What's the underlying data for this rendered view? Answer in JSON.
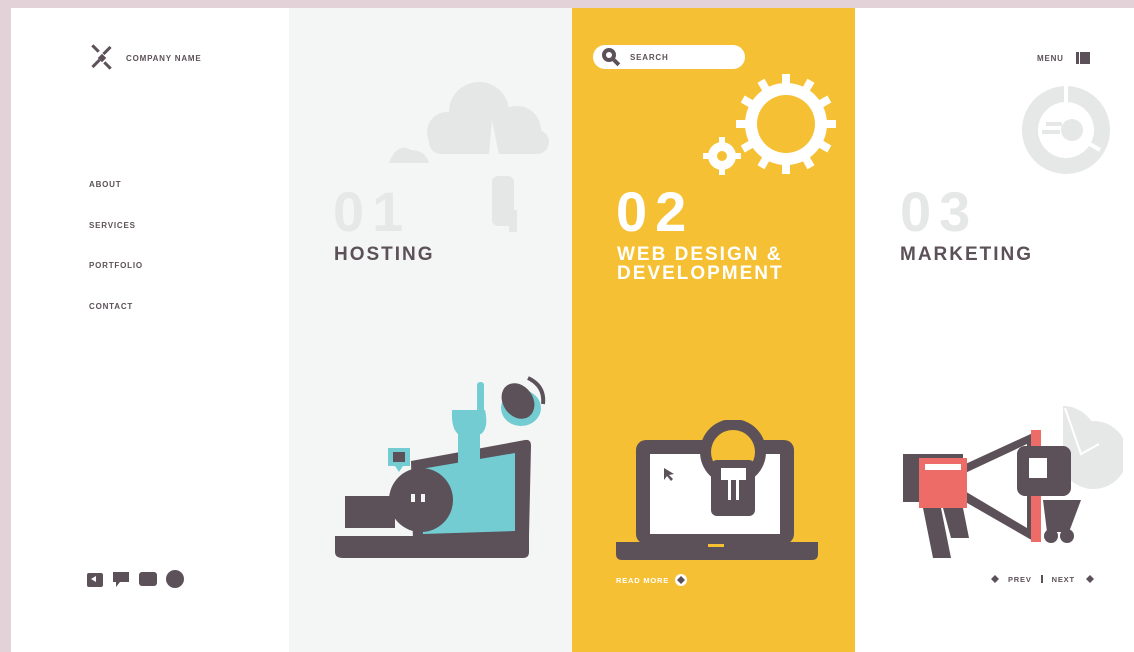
{
  "brand": {
    "name": "COMPANY NAME",
    "logo_icon": "x-logo-icon"
  },
  "nav": {
    "items": [
      {
        "label": "ABOUT"
      },
      {
        "label": "SERVICES"
      },
      {
        "label": "PORTFOLIO"
      },
      {
        "label": "CONTACT"
      }
    ]
  },
  "social": [
    "share-icon",
    "chat-icon",
    "video-icon",
    "globe-icon"
  ],
  "search": {
    "placeholder": "SEARCH",
    "icon": "search-icon"
  },
  "services": [
    {
      "number": "01",
      "title": "HOSTING",
      "illustration": "laptop-cloud-icon"
    },
    {
      "number": "02",
      "title": "WEB DESIGN & DEVELOPMENT",
      "illustration": "laptop-lightbulb-icon"
    },
    {
      "number": "03",
      "title": "MARKETING",
      "illustration": "megaphone-icon"
    }
  ],
  "read_more": {
    "label": "READ MORE"
  },
  "menu": {
    "label": "MENU"
  },
  "pager": {
    "prev": "PREV",
    "next": "NEXT"
  },
  "colors": {
    "background": "#e3d2d7",
    "accent_yellow": "#f5c033",
    "panel_light": "#f4f6f5",
    "text_dark": "#5c5158",
    "teal": "#72ccd2",
    "coral": "#ee6c67",
    "ghost_gray": "#e6e7e7"
  }
}
